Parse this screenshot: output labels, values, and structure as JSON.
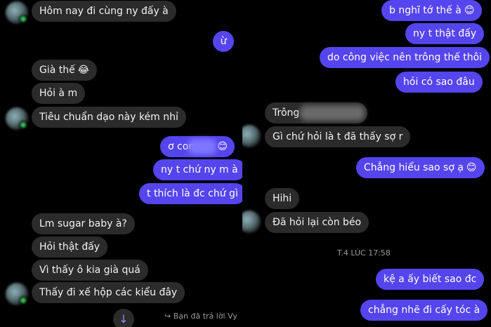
{
  "left": {
    "messages": [
      {
        "id": "m1",
        "text": "Hôm nay đi cùng ny đấy à",
        "emoji": ""
      },
      {
        "id": "m2",
        "text": "ừ",
        "emoji": ""
      },
      {
        "id": "m3",
        "text": "Già thế",
        "emoji": "😂"
      },
      {
        "id": "m4",
        "text": "Hỏi à m",
        "emoji": ""
      },
      {
        "id": "m5",
        "text": "Tiêu chuẩn dạo này kém nhỉ",
        "emoji": ""
      },
      {
        "id": "m6",
        "text": "ơ con ",
        "emoji": "😊"
      },
      {
        "id": "m7",
        "text": "ny t chứ ny m à",
        "emoji": ""
      },
      {
        "id": "m8",
        "text": "t thích là đc chứ gì",
        "emoji": ""
      },
      {
        "id": "m9",
        "text": "Lm sugar baby à?",
        "emoji": ""
      },
      {
        "id": "m10",
        "text": "Hỏi thật đấy",
        "emoji": ""
      },
      {
        "id": "m11",
        "text": "Vì thấy ô kia già quá",
        "emoji": ""
      },
      {
        "id": "m12",
        "text": "Thấy đi xế hộp các kiểu đây",
        "emoji": ""
      }
    ],
    "reply_notice": "↪ Bạn đã trả lời Vy",
    "scroll_down_icon": "↓"
  },
  "right": {
    "messages": [
      {
        "id": "r1",
        "text": "b nghĩ tớ thế à",
        "emoji": "😊"
      },
      {
        "id": "r2",
        "text": "ny t thật đấy",
        "emoji": ""
      },
      {
        "id": "r3",
        "text": "do công việc nên trông thế thôi",
        "emoji": ""
      },
      {
        "id": "r4",
        "text": "hỏi có sao đâu",
        "emoji": ""
      },
      {
        "id": "r5",
        "text": "Trông ",
        "emoji": ""
      },
      {
        "id": "r6",
        "text": "Gì chứ hỏi là t đã thấy sợ r",
        "emoji": ""
      },
      {
        "id": "r7",
        "text": "Chẳng hiểu sao sợ ạ",
        "emoji": "😊"
      },
      {
        "id": "r8",
        "text": "Hihi",
        "emoji": ""
      },
      {
        "id": "r9",
        "text": "Đã hỏi lại còn béo",
        "emoji": ""
      },
      {
        "id": "r10",
        "text": "kệ a ấy biết sao đc",
        "emoji": ""
      },
      {
        "id": "r11",
        "text": "chẳng nhẽ đi cấy tóc à",
        "emoji": ""
      }
    ],
    "timestamp": "T.4 LÚC 17:58"
  },
  "colors": {
    "background": "#000000",
    "incoming_bubble": "#2b2b2b",
    "outgoing_bubble": "#5545ee",
    "online": "#38c85c"
  }
}
